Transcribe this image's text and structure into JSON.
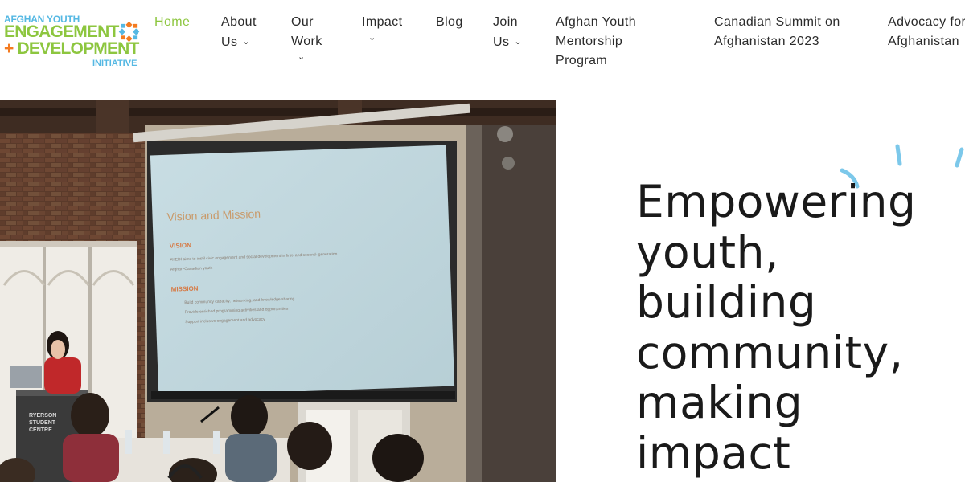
{
  "logo": {
    "line1": "AFGHAN YOUTH",
    "line2": "ENGAGEMENT",
    "line3_plus": "+",
    "line3_text": "DEVELOPMENT",
    "line4": "INITIATIVE",
    "icon": "star-pattern-icon"
  },
  "nav": {
    "home": {
      "line1": "Home"
    },
    "about": {
      "line1": "About",
      "line2": "Us",
      "icon": "chevron-down-icon"
    },
    "work": {
      "line1": "Our",
      "line2": "Work",
      "icon": "chevron-down-icon"
    },
    "impact": {
      "line1": "Impact",
      "icon": "chevron-down-icon"
    },
    "blog": {
      "line1": "Blog"
    },
    "join": {
      "line1": "Join",
      "line2": "Us",
      "icon": "chevron-down-icon"
    },
    "mentorship": {
      "line1": "Afghan Youth",
      "line2": "Mentorship",
      "line3": "Program"
    },
    "summit": {
      "line1": "Canadian Summit on",
      "line2": "Afghanistan 2023"
    },
    "advocacy": {
      "line1": "Advocacy for",
      "line2": "Afghanistan"
    }
  },
  "slide": {
    "title": "Vision and Mission",
    "vision_heading": "VISION",
    "vision_text_1": "AYEDI aims to instil civic engagement and social development in first- and second- generation",
    "vision_text_2": "Afghan-Canadian youth",
    "mission_heading": "MISSION",
    "mission_items": [
      "Build community capacity, networking, and knowledge sharing",
      "Provide enriched programming activities and opportunities",
      "Support inclusive engagement and advocacy"
    ],
    "podium_line1": "RYERSON",
    "podium_line2": "STUDENT",
    "podium_line3": "CENTRE"
  },
  "hero": {
    "line1": "Empowering",
    "line2": "youth,",
    "line3": "building",
    "line4": "community,",
    "line5": "making",
    "line6": "impact"
  },
  "colors": {
    "accent_green": "#8dc63f",
    "accent_blue": "#55b8e3",
    "accent_orange": "#f47b20",
    "text_dark": "#1a1a1a",
    "deco_blue": "#7cc8ea"
  }
}
